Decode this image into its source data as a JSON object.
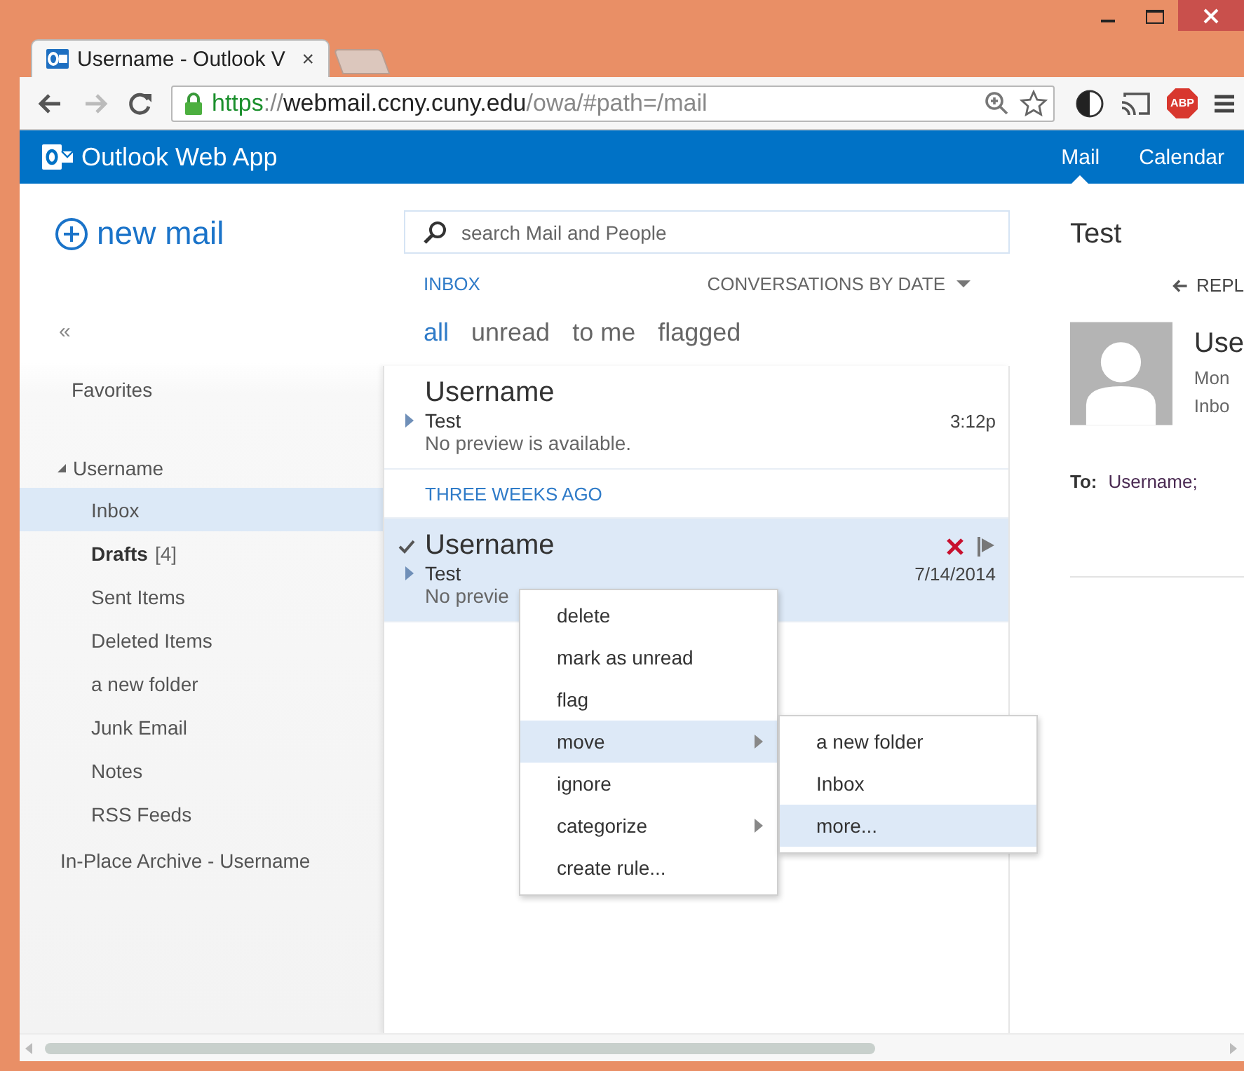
{
  "browser": {
    "tab_title": "Username - Outlook V",
    "tab_close": "×",
    "url": [
      {
        "kind": "scheme",
        "text": "https"
      },
      {
        "kind": "sep",
        "text": "://"
      },
      {
        "kind": "host",
        "text": "webmail.ccny.cuny.edu"
      },
      {
        "kind": "path",
        "text": "/owa/#path=/mail"
      }
    ],
    "abp_badge": "ABP"
  },
  "header": {
    "app_name": "Outlook Web App",
    "nav": [
      {
        "label": "Mail",
        "selected": true
      },
      {
        "label": "Calendar",
        "selected": false
      }
    ]
  },
  "folder_pane": {
    "new_mail": "new mail",
    "collapse": "«",
    "favorites": "Favorites",
    "account": {
      "name": "Username",
      "expanded": true,
      "children": [
        {
          "name": "Inbox",
          "selected": true,
          "unread": false
        },
        {
          "name": "Drafts",
          "count": "[4]",
          "selected": false,
          "unread": true
        },
        {
          "name": "Sent Items",
          "selected": false,
          "unread": false
        },
        {
          "name": "Deleted Items",
          "selected": false,
          "unread": false
        },
        {
          "name": "a new folder",
          "selected": false,
          "unread": false
        },
        {
          "name": "Junk Email",
          "selected": false,
          "unread": false
        },
        {
          "name": "Notes",
          "selected": false,
          "unread": false
        },
        {
          "name": "RSS Feeds",
          "selected": false,
          "unread": false
        }
      ]
    },
    "archive": "In-Place Archive - Username"
  },
  "mail_list": {
    "search": {
      "placeholder": "search Mail and People"
    },
    "folder_title": "INBOX",
    "sort": "CONVERSATIONS BY DATE",
    "filters": [
      {
        "label": "all",
        "selected": true
      },
      {
        "label": "unread",
        "selected": false
      },
      {
        "label": "to me",
        "selected": false
      },
      {
        "label": "flagged",
        "selected": false
      }
    ],
    "items": [
      {
        "kind": "message",
        "sender": "Username",
        "subject": "Test",
        "preview": "No preview is available.",
        "time": "3:12p",
        "selected": false,
        "checked": false
      },
      {
        "kind": "group",
        "label": "THREE WEEKS AGO"
      },
      {
        "kind": "message",
        "sender": "Username",
        "subject": "Test",
        "preview": "No previe",
        "time": "7/14/2014",
        "selected": true,
        "checked": true
      }
    ]
  },
  "reading_pane": {
    "subject": "Test",
    "reply": "REPL",
    "sender": "Use",
    "date": "Mon",
    "folder": "Inbo",
    "to_label": "To:",
    "to": "Username;"
  },
  "context_menu": {
    "items": [
      {
        "label": "delete",
        "submenu": false,
        "selected": false
      },
      {
        "label": "mark as unread",
        "submenu": false,
        "selected": false
      },
      {
        "label": "flag",
        "submenu": false,
        "selected": false
      },
      {
        "label": "move",
        "submenu": true,
        "selected": true
      },
      {
        "label": "ignore",
        "submenu": false,
        "selected": false
      },
      {
        "label": "categorize",
        "submenu": true,
        "selected": false
      },
      {
        "label": "create rule...",
        "submenu": false,
        "selected": false
      }
    ],
    "submenu": {
      "items": [
        {
          "label": "a new folder",
          "selected": false
        },
        {
          "label": "Inbox",
          "selected": false
        },
        {
          "label": "more...",
          "selected": true
        }
      ]
    }
  }
}
